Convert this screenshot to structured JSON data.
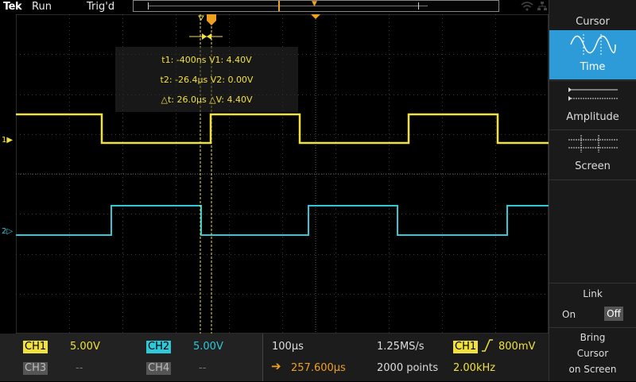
{
  "topbar": {
    "brand": "Tek",
    "run_state": "Run",
    "trigger_state": "Trig'd"
  },
  "readout": {
    "line1": "t1: -400ns  V1: 4.40V",
    "line2": "t2: -26.4µs  V2: 0.00V",
    "line3": "△t: 26.0µs  △V: 4.40V"
  },
  "channel_markers": {
    "ch1": "1",
    "ch2": "2"
  },
  "menu": {
    "title": "Cursor",
    "time_label": "Time",
    "amplitude_label": "Amplitude",
    "screen_label": "Screen",
    "link_label": "Link",
    "link_on": "On",
    "link_off": "Off",
    "bring_line1": "Bring",
    "bring_line2": "Cursor",
    "bring_line3": "on Screen"
  },
  "bottom": {
    "ch1_label": "CH1",
    "ch1_scale": "5.00V",
    "ch2_label": "CH2",
    "ch2_scale": "5.00V",
    "ch3_label": "CH3",
    "ch3_scale": "--",
    "ch4_label": "CH4",
    "ch4_scale": "--",
    "timebase": "100µs",
    "sample_rate": "1.25MS/s",
    "position": "257.600µs",
    "record_length": "2000 points",
    "trig_source": "CH1",
    "trig_level": "800mV",
    "trig_freq": "2.00kHz"
  },
  "colors": {
    "ch1": "#f0e040",
    "ch2": "#30c8d8",
    "accent": "#2d9bd8",
    "trigger": "#f0a020"
  }
}
